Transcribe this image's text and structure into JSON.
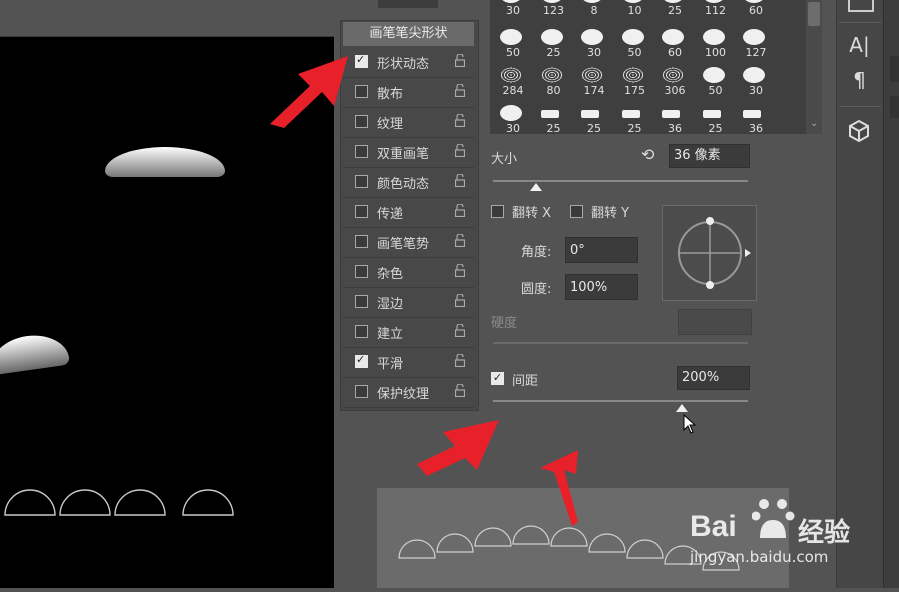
{
  "brush_panel": {
    "tip_shape_header": "画笔笔尖形状",
    "options": [
      {
        "label": "形状动态",
        "checked": true
      },
      {
        "label": "散布",
        "checked": false
      },
      {
        "label": "纹理",
        "checked": false
      },
      {
        "label": "双重画笔",
        "checked": false
      },
      {
        "label": "颜色动态",
        "checked": false
      },
      {
        "label": "传递",
        "checked": false
      },
      {
        "label": "画笔笔势",
        "checked": false
      },
      {
        "label": "杂色",
        "checked": false
      },
      {
        "label": "湿边",
        "checked": false
      },
      {
        "label": "建立",
        "checked": false
      },
      {
        "label": "平滑",
        "checked": true
      },
      {
        "label": "保护纹理",
        "checked": false
      }
    ]
  },
  "brush_grid": {
    "rows": [
      [
        "30",
        "123",
        "8",
        "10",
        "25",
        "112",
        "60"
      ],
      [
        "50",
        "25",
        "30",
        "50",
        "60",
        "100",
        "127"
      ],
      [
        "284",
        "80",
        "174",
        "175",
        "306",
        "50",
        "30"
      ],
      [
        "30",
        "25",
        "25",
        "25",
        "36",
        "25",
        "36"
      ]
    ]
  },
  "tip_settings": {
    "size_label": "大小",
    "size_value": "36 像素",
    "size_slider_fraction": 0.17,
    "flip_x_label": "翻转 X",
    "flip_y_label": "翻转 Y",
    "angle_label": "角度:",
    "angle_value": "0°",
    "roundness_label": "圆度:",
    "roundness_value": "100%",
    "hardness_label": "硬度",
    "spacing_label": "间距",
    "spacing_checked": true,
    "spacing_value": "200%",
    "spacing_slider_fraction": 0.74
  },
  "right_tools": {
    "text_icon": "A|",
    "paragraph_icon": "¶",
    "cube_icon": "cube"
  },
  "watermark": {
    "brand": "Bai",
    "brand_suffix": "经验",
    "url": "jingyan.baidu.com"
  },
  "colors": {
    "annotation_arrow": "#e8202a",
    "panel_bg": "#535353",
    "canvas_bg": "#000000"
  }
}
